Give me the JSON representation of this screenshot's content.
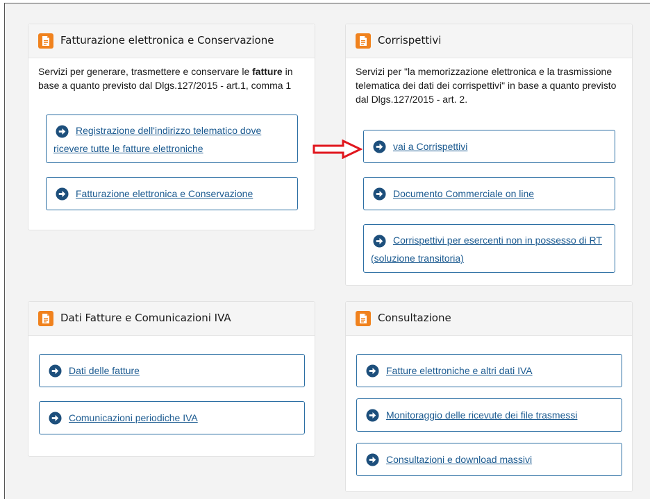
{
  "colors": {
    "accent_orange": "#f0821e",
    "link_blue": "#1b5a90",
    "border_blue": "#2b6ea3",
    "arrow_red": "#e0161e"
  },
  "icons": {
    "card_icon": "document-icon",
    "link_icon": "arrow-circle-right-icon",
    "pointer": "red-arrow-icon"
  },
  "cards": {
    "fatturazione": {
      "title": "Fatturazione elettronica e Conservazione",
      "desc_before": "Servizi per generare, trasmettere e conservare le ",
      "desc_bold": "fatture",
      "desc_after": " in base a quanto previsto dal Dlgs.127/2015 - art.1, comma 1",
      "links": [
        "Registrazione dell'indirizzo telematico dove ricevere tutte le fatture elettroniche",
        "Fatturazione elettronica e Conservazione"
      ]
    },
    "corrispettivi": {
      "title": "Corrispettivi",
      "desc": "Servizi per \"la memorizzazione elettronica e la trasmissione telematica dei dati dei corrispettivi\" in base a quanto previsto dal Dlgs.127/2015 - art. 2.",
      "links": [
        "vai a Corrispettivi",
        "Documento Commerciale on line",
        "Corrispettivi per esercenti non in possesso di RT (soluzione transitoria)"
      ]
    },
    "dati_fatture": {
      "title": "Dati Fatture e Comunicazioni IVA",
      "links": [
        "Dati delle fatture",
        "Comunicazioni periodiche IVA"
      ]
    },
    "consultazione": {
      "title": "Consultazione",
      "links": [
        "Fatture elettroniche e altri dati IVA",
        "Monitoraggio delle ricevute dei file trasmessi",
        "Consultazioni e download massivi"
      ]
    }
  }
}
